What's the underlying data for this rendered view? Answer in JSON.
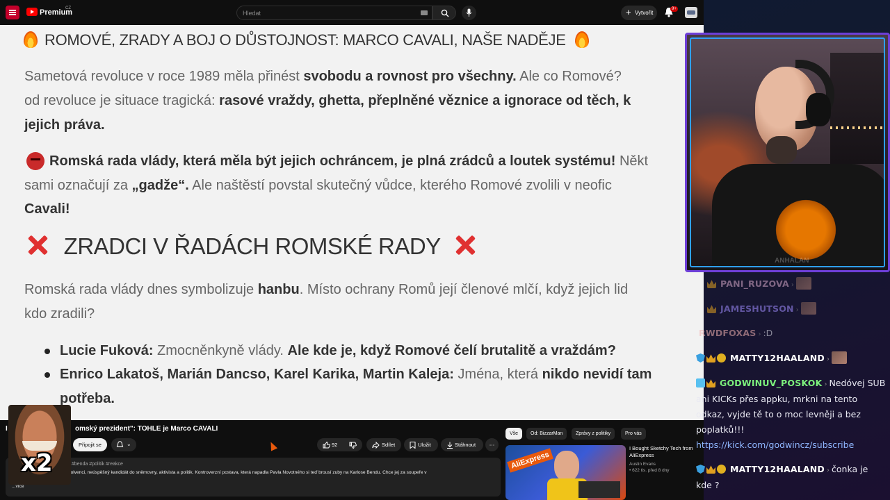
{
  "youtube": {
    "brand": "Premium",
    "brand_sup": "CZ",
    "search_placeholder": "Hledat",
    "create_label": "Vytvořit",
    "notifications_badge": "9+"
  },
  "article": {
    "heading_main": "ROMOVÉ, ZRADY A BOJ O DŮSTOJNOST: MARCO CAVALI, NAŠE NADĚJE",
    "p1_line1_normal": "Sametová revoluce v roce 1989 měla přinést ",
    "p1_line1_bold": "svobodu a rovnost pro všechny.",
    "p1_line1_tail": " Ale co Romové?",
    "p1_line2_normal": "od revoluce je situace tragická: ",
    "p1_line2_bold": "rasové vraždy, ghetta, přeplněné věznice a ignorace od těch, k",
    "p1_line3_bold": "jejich práva.",
    "p2_line1_bold": "Romská rada vlády, která měla být jejich ochráncem, je plná zrádců a loutek systému!",
    "p2_line1_tail": " Někt",
    "p2_line2_normal": "sami označují za ",
    "p2_line2_bold": "„gadže“.",
    "p2_line2_tail": " Ale naštěstí povstal skutečný vůdce, kterého Romové zvolili v neofic",
    "p2_line3_bold": "Cavali!",
    "heading_second": "ZRADCI V ŘADÁCH ROMSKÉ RADY",
    "p3_line1_normal": "Romská rada vlády dnes symbolizuje ",
    "p3_line1_bold": "hanbu",
    "p3_line1_tail": ". Místo ochrany Romů její členové mlčí, když jejich lid",
    "p3_line2_normal": "kdo zradili?",
    "bullet1_bold": "Lucie Fuková:",
    "bullet1_normal": " Zmocněnkyně vlády. ",
    "bullet1_bold2": "Ale kde je, když Romové čelí brutalitě a vraždám?",
    "bullet2_bold": "Enrico Lakatoš, Marián Dancso, Karel Karika, Martin Kaleja:",
    "bullet2_normal": " Jména, která ",
    "bullet2_bold2": "nikdo nevidí tam",
    "bullet2_line2_bold": "potřeba."
  },
  "video": {
    "title_lead": "I",
    "title": "omský prezident\": TOHLE je Marco CAVALI",
    "join_label": "Připojit se",
    "likes": "92",
    "share_label": "Sdílet",
    "save_label": "Uložit",
    "download_label": "Stáhnout",
    "more_label": "⋯",
    "tag_lead": "y",
    "tags": "#benda #politik #reakce",
    "description_line1": "Marco   ali,   ský podnikatel v insolvenci, neúspěšný kandidát do sněmovny, aktivista a politik. Kontroverzní postava, která napadla Pavla Novotného si teď brousí zuby na Karlose Bendu. Chce jej za soupeře v",
    "description_line2": "rámc                    a Clash 17.",
    "more_link": "...více"
  },
  "recommendations": {
    "chips": [
      "Vše",
      "Od: BizzarMan",
      "Zprávy z politiky",
      "Pro vás"
    ],
    "active_chip": 0,
    "item_title": "I Bought Sketchy Tech from AliExpress",
    "item_channel": "Austin Evans",
    "item_meta": "• 622 tis.   před 8 dny",
    "thumb_text": "AliExpress"
  },
  "emote": {
    "multiplier": "x2"
  },
  "webcam": {
    "watermark": "ANHALAN"
  },
  "chat": {
    "messages": [
      {
        "user": "PANI_RUZOVA",
        "text": "",
        "color": "#d6a8c8",
        "faded": true
      },
      {
        "user": "JAMESHUTSON",
        "text": "",
        "color": "#a08cff",
        "faded": true
      },
      {
        "user": "RWDFOXAS",
        "text": ":D",
        "color": "#f0b0b0",
        "faded": true
      },
      {
        "user": "MATTY12HAALAND",
        "text": "",
        "color": "#ffffff",
        "faded": false
      },
      {
        "user": "GODWINUV_POSKOK",
        "text": "Nedóvej SUB",
        "color": "#7cf07c",
        "faded": false
      },
      {
        "user": "",
        "text": "ani KICKs přes appku, mrkni na tento",
        "color": "",
        "faded": false
      },
      {
        "user": "",
        "text": "odkaz, vyjde tě to o moc levněji a bez",
        "color": "",
        "faded": false
      },
      {
        "user": "",
        "text": "poplatků!!!",
        "color": "",
        "faded": false
      },
      {
        "user": "",
        "text": "https://kick.com/godwincz/subscribe",
        "color": "",
        "faded": false
      },
      {
        "user": "MATTY12HAALAND",
        "text": "čonka je",
        "color": "#ffffff",
        "faded": false
      },
      {
        "user": "",
        "text": "kde ?",
        "color": "",
        "faded": false
      }
    ]
  },
  "colors": {
    "webcam_frame": "#6e3fd8",
    "webcam_inner_border": "#2fa0ff",
    "yt_red": "#ff0000",
    "chat_link": "#8fb6ff"
  }
}
